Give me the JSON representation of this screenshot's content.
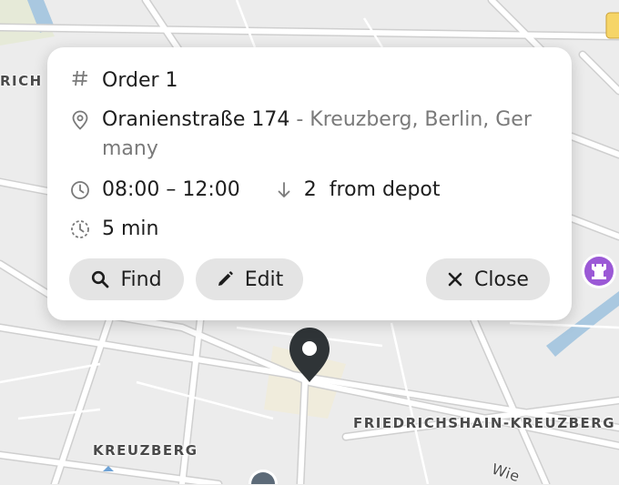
{
  "map": {
    "labels": {
      "top_left": "RICH",
      "friedrichshain": "FRIEDRICHSHAIN-KREUZBERG",
      "kreuzberg": "KREUZBERG",
      "street_partial": "Wie"
    },
    "colors": {
      "background": "#ececec",
      "road": "#ffffff",
      "road_outline": "#d2d2d2",
      "water": "#a9c8e0",
      "park": "#dfe7d6",
      "marker": "#2f3437",
      "poi_purple": "#9b59d6"
    },
    "icons": [
      "map-pin-icon",
      "rook-icon",
      "poi-icon"
    ]
  },
  "popup": {
    "order_icon": "hash-icon",
    "order_title": "Order 1",
    "address_icon": "location-pin-icon",
    "address_street": "Oranienstraße 174",
    "address_rest": " - Kreuzberg, Berlin, Ger",
    "address_wrap": "many",
    "time_icon": "clock-icon",
    "time_window": "08:00 – 12:00",
    "sequence_icon": "arrow-down-icon",
    "sequence_text": "2  from depot",
    "duration_icon": "timer-icon",
    "duration": "5 min",
    "buttons": {
      "find": "Find",
      "edit": "Edit",
      "close": "Close"
    }
  }
}
